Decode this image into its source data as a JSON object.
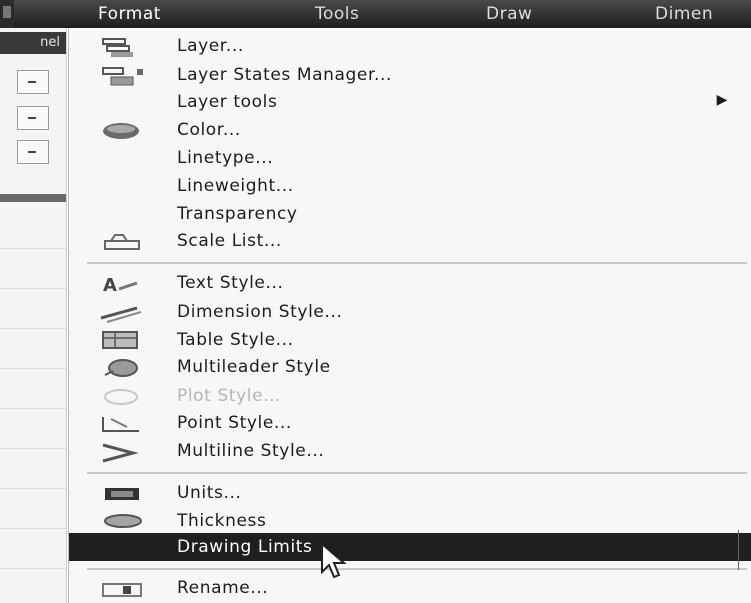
{
  "menubar": {
    "items": [
      "Format",
      "Tools",
      "Draw",
      "Dimen"
    ]
  },
  "left_panel": {
    "tab_label": "nel"
  },
  "format_menu": {
    "items": [
      {
        "label": "Layer...",
        "icon": "layer-icon"
      },
      {
        "label": "Layer States Manager...",
        "icon": "layer-states-icon"
      },
      {
        "label": "Layer tools",
        "icon": "",
        "submenu": true
      },
      {
        "label": "Color...",
        "icon": "color-icon"
      },
      {
        "label": "Linetype...",
        "icon": ""
      },
      {
        "label": "Lineweight...",
        "icon": ""
      },
      {
        "label": "Transparency",
        "icon": ""
      },
      {
        "label": "Scale List...",
        "icon": "scale-list-icon"
      },
      {
        "label": "Text Style...",
        "icon": "text-style-icon"
      },
      {
        "label": "Dimension Style...",
        "icon": "dimension-style-icon"
      },
      {
        "label": "Table Style...",
        "icon": "table-style-icon"
      },
      {
        "label": "Multileader Style",
        "icon": "multileader-style-icon"
      },
      {
        "label": "Plot Style...",
        "icon": "plot-style-icon",
        "disabled": true
      },
      {
        "label": "Point Style...",
        "icon": "point-style-icon"
      },
      {
        "label": "Multiline Style...",
        "icon": "multiline-style-icon"
      },
      {
        "label": "Units...",
        "icon": "units-icon"
      },
      {
        "label": "Thickness",
        "icon": "thickness-icon"
      },
      {
        "label": "Drawing Limits",
        "icon": "",
        "highlighted": true
      },
      {
        "label": "Rename...",
        "icon": "rename-icon"
      }
    ],
    "submenu_arrow": "▶"
  }
}
